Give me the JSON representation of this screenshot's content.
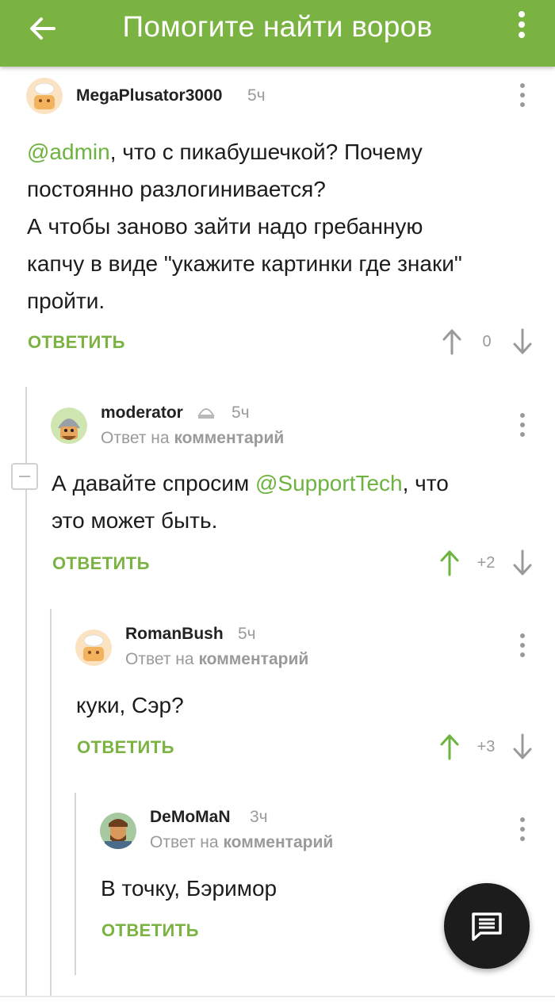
{
  "header": {
    "title": "Помогите найти воров",
    "back_icon": "arrow-left-icon",
    "menu_icon": "more-vertical-icon",
    "background": "#7bb342"
  },
  "comments": [
    {
      "author": "MegaPlusator3000",
      "time": "5ч",
      "text_mention": "@admin",
      "text_lines": [
        ", что с пикабушечкой? Почему",
        "постоянно разлогинивается?",
        "А чтобы заново зайти надо гребанную",
        "капчу в виде \"укажите картинки где знаки\"",
        "пройти."
      ],
      "reply_label": "ОТВЕТИТЬ",
      "rating": "0"
    },
    {
      "author": "moderator",
      "time": "5ч",
      "reply_to_prefix": "Ответ на",
      "reply_to_target": "комментарий",
      "text_before": "А давайте спросим ",
      "text_mention": "@SupportTech",
      "text_after": ", что",
      "text_line2": "это может быть.",
      "reply_label": "ОТВЕТИТЬ",
      "rating": "+2"
    },
    {
      "author": "RomanBush",
      "time": "5ч",
      "reply_to_prefix": "Ответ на",
      "reply_to_target": "комментарий",
      "text": "куки, Сэр?",
      "reply_label": "ОТВЕТИТЬ",
      "rating": "+3"
    },
    {
      "author": "DeMoMaN",
      "time": "3ч",
      "reply_to_prefix": "Ответ на",
      "reply_to_target": "комментарий",
      "text": "В точку, Бэримор",
      "reply_label": "ОТВЕТИТЬ"
    }
  ],
  "fab": {
    "icon": "comment-icon"
  },
  "colors": {
    "accent": "#7bb342",
    "mention": "#6db33f",
    "muted": "#9a9a9a"
  }
}
